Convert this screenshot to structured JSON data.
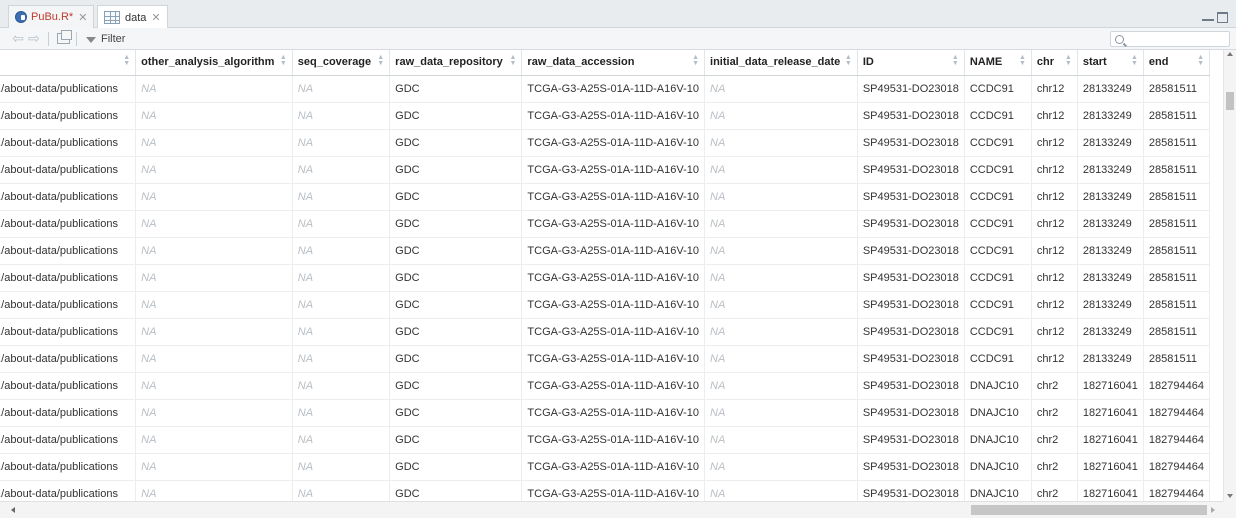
{
  "tabs": [
    {
      "label": "PuBu.R*",
      "icon": "r-script-icon",
      "modified": true,
      "active": false
    },
    {
      "label": "data",
      "icon": "data-grid-icon",
      "active": true
    }
  ],
  "toolbar": {
    "filter_label": "Filter",
    "search_placeholder": ""
  },
  "columns": [
    "",
    "other_analysis_algorithm",
    "seq_coverage",
    "raw_data_repository",
    "raw_data_accession",
    "initial_data_release_date",
    "ID",
    "NAME",
    "chr",
    "start",
    "end"
  ],
  "rows": [
    [
      "about-data/publications/...",
      "NA",
      "NA",
      "GDC",
      "TCGA-G3-A25S-01A-11D-A16V-10",
      "NA",
      "SP49531-DO23018",
      "CCDC91",
      "chr12",
      "28133249",
      "28581511"
    ],
    [
      "about-data/publications/...",
      "NA",
      "NA",
      "GDC",
      "TCGA-G3-A25S-01A-11D-A16V-10",
      "NA",
      "SP49531-DO23018",
      "CCDC91",
      "chr12",
      "28133249",
      "28581511"
    ],
    [
      "about-data/publications/...",
      "NA",
      "NA",
      "GDC",
      "TCGA-G3-A25S-01A-11D-A16V-10",
      "NA",
      "SP49531-DO23018",
      "CCDC91",
      "chr12",
      "28133249",
      "28581511"
    ],
    [
      "about-data/publications/...",
      "NA",
      "NA",
      "GDC",
      "TCGA-G3-A25S-01A-11D-A16V-10",
      "NA",
      "SP49531-DO23018",
      "CCDC91",
      "chr12",
      "28133249",
      "28581511"
    ],
    [
      "about-data/publications/...",
      "NA",
      "NA",
      "GDC",
      "TCGA-G3-A25S-01A-11D-A16V-10",
      "NA",
      "SP49531-DO23018",
      "CCDC91",
      "chr12",
      "28133249",
      "28581511"
    ],
    [
      "about-data/publications/...",
      "NA",
      "NA",
      "GDC",
      "TCGA-G3-A25S-01A-11D-A16V-10",
      "NA",
      "SP49531-DO23018",
      "CCDC91",
      "chr12",
      "28133249",
      "28581511"
    ],
    [
      "about-data/publications/...",
      "NA",
      "NA",
      "GDC",
      "TCGA-G3-A25S-01A-11D-A16V-10",
      "NA",
      "SP49531-DO23018",
      "CCDC91",
      "chr12",
      "28133249",
      "28581511"
    ],
    [
      "about-data/publications/...",
      "NA",
      "NA",
      "GDC",
      "TCGA-G3-A25S-01A-11D-A16V-10",
      "NA",
      "SP49531-DO23018",
      "CCDC91",
      "chr12",
      "28133249",
      "28581511"
    ],
    [
      "about-data/publications/...",
      "NA",
      "NA",
      "GDC",
      "TCGA-G3-A25S-01A-11D-A16V-10",
      "NA",
      "SP49531-DO23018",
      "CCDC91",
      "chr12",
      "28133249",
      "28581511"
    ],
    [
      "about-data/publications/...",
      "NA",
      "NA",
      "GDC",
      "TCGA-G3-A25S-01A-11D-A16V-10",
      "NA",
      "SP49531-DO23018",
      "CCDC91",
      "chr12",
      "28133249",
      "28581511"
    ],
    [
      "about-data/publications/...",
      "NA",
      "NA",
      "GDC",
      "TCGA-G3-A25S-01A-11D-A16V-10",
      "NA",
      "SP49531-DO23018",
      "CCDC91",
      "chr12",
      "28133249",
      "28581511"
    ],
    [
      "about-data/publications/...",
      "NA",
      "NA",
      "GDC",
      "TCGA-G3-A25S-01A-11D-A16V-10",
      "NA",
      "SP49531-DO23018",
      "DNAJC10",
      "chr2",
      "182716041",
      "182794464"
    ],
    [
      "about-data/publications/...",
      "NA",
      "NA",
      "GDC",
      "TCGA-G3-A25S-01A-11D-A16V-10",
      "NA",
      "SP49531-DO23018",
      "DNAJC10",
      "chr2",
      "182716041",
      "182794464"
    ],
    [
      "about-data/publications/...",
      "NA",
      "NA",
      "GDC",
      "TCGA-G3-A25S-01A-11D-A16V-10",
      "NA",
      "SP49531-DO23018",
      "DNAJC10",
      "chr2",
      "182716041",
      "182794464"
    ],
    [
      "about-data/publications/...",
      "NA",
      "NA",
      "GDC",
      "TCGA-G3-A25S-01A-11D-A16V-10",
      "NA",
      "SP49531-DO23018",
      "DNAJC10",
      "chr2",
      "182716041",
      "182794464"
    ],
    [
      "about-data/publications/...",
      "NA",
      "NA",
      "GDC",
      "TCGA-G3-A25S-01A-11D-A16V-10",
      "NA",
      "SP49531-DO23018",
      "DNAJC10",
      "chr2",
      "182716041",
      "182794464"
    ]
  ],
  "colors": {
    "modified_tab_text": "#c0392b",
    "na_text": "#b8bec4"
  }
}
